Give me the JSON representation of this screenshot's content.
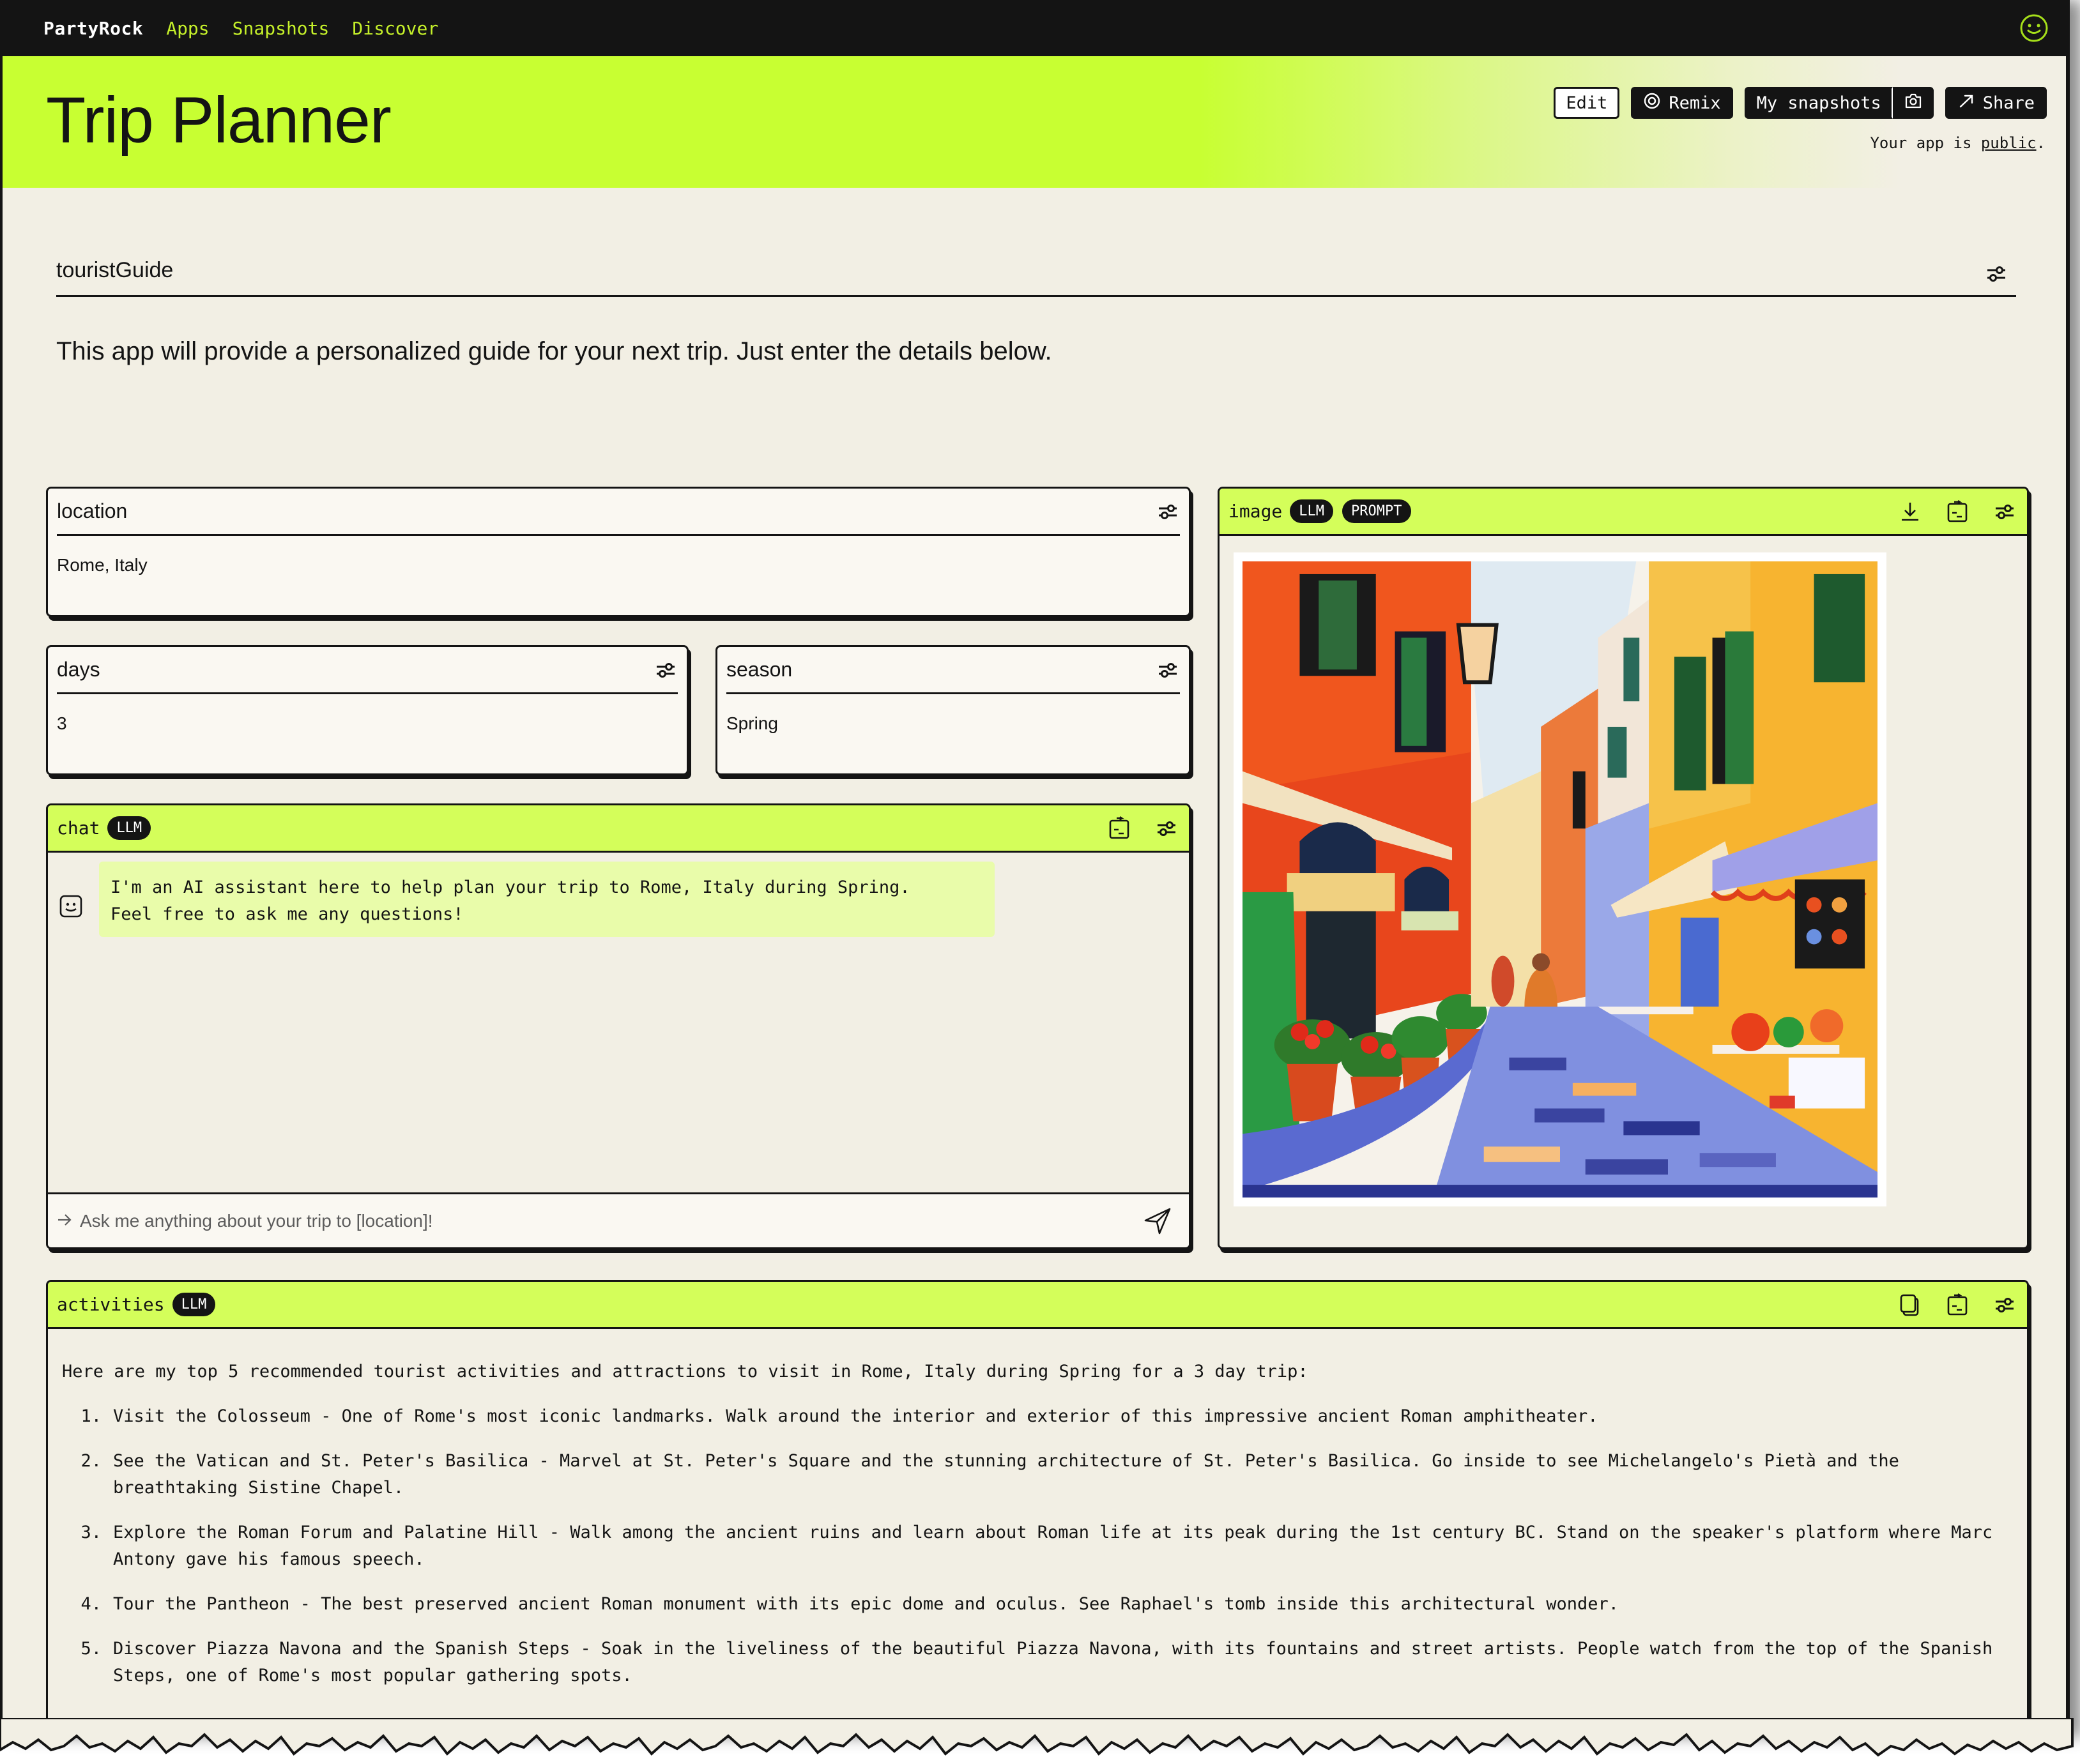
{
  "nav": {
    "brand": "PartyRock",
    "links": [
      "Apps",
      "Snapshots",
      "Discover"
    ],
    "avatar_icon": "smiley-face-icon",
    "accent": "#c5f02a"
  },
  "hero": {
    "title": "Trip Planner",
    "buttons": {
      "edit": "Edit",
      "remix": "Remix",
      "snapshots": "My snapshots",
      "share": "Share"
    },
    "visibility_prefix": "Your app is ",
    "visibility_link": "public",
    "visibility_suffix": ".",
    "accent": "#c8ff32"
  },
  "app": {
    "name": "touristGuide",
    "description": "This app will provide a personalized guide for your next trip. Just enter the details below."
  },
  "widgets": {
    "location": {
      "label": "location",
      "value": "Rome, Italy"
    },
    "days": {
      "label": "days",
      "value": "3"
    },
    "season": {
      "label": "season",
      "value": "Spring"
    },
    "chat": {
      "label": "chat",
      "badge": "LLM",
      "message": "I'm an AI assistant here to help plan your trip to Rome, Italy during Spring.\nFeel free to ask me any questions!",
      "input_placeholder": "Ask me anything about your trip to [location]!"
    },
    "image": {
      "label": "image",
      "badges": [
        "LLM",
        "PROMPT"
      ],
      "alt": "Painted illustration of a colorful narrow Roman street with outdoor cafe tables, flower pots and cobblestones"
    },
    "activities": {
      "label": "activities",
      "badge": "LLM",
      "intro": "Here are my top 5 recommended tourist activities and attractions to visit in Rome, Italy during Spring for a 3 day trip:",
      "items": [
        {
          "num": "1.",
          "text": "Visit the Colosseum - One of Rome's most iconic landmarks. Walk around the interior and exterior of this impressive ancient Roman amphitheater."
        },
        {
          "num": "2.",
          "text": "See the Vatican and St. Peter's Basilica - Marvel at St. Peter's Square and the stunning architecture of St. Peter's Basilica. Go inside to see Michelangelo's Pietà and the breathtaking Sistine Chapel."
        },
        {
          "num": "3.",
          "text": "Explore the Roman Forum and Palatine Hill - Walk among the ancient ruins and learn about Roman life at its peak during the 1st century BC. Stand on the speaker's platform where Marc Antony gave his famous speech."
        },
        {
          "num": "4.",
          "text": "Tour the Pantheon - The best preserved ancient Roman monument with its epic dome and oculus. See Raphael's tomb inside this architectural wonder."
        },
        {
          "num": "5.",
          "text": "Discover Piazza Navona and the Spanish Steps - Soak in the liveliness of the beautiful Piazza Navona, with its fountains and street artists. People watch from the top of the Spanish Steps, one of Rome's most popular gathering spots."
        }
      ]
    }
  },
  "colors": {
    "dark": "#141414",
    "lime_header": "#d4fe5a",
    "cream_bg": "#f2efe4",
    "chat_bubble": "#e9fcaa"
  }
}
